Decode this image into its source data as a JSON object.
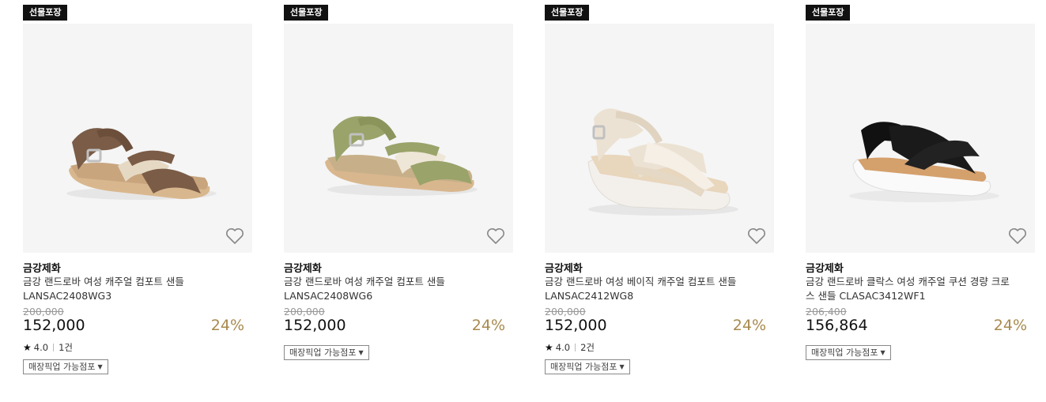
{
  "products": [
    {
      "badge": "선물포장",
      "brand": "금강제화",
      "name": "금강 랜드로바 여성 캐주얼 컴포트 샌들 LANSAC2408WG3",
      "original_price": "200,000",
      "price": "152,000",
      "discount": "24%",
      "rating": "4.0",
      "reviews": "1건",
      "pickup_label": "매장픽업 가능점포",
      "colors": {
        "strap": "#7a5c47",
        "accent": "#e6d9c4",
        "sole": "#d9b78e"
      }
    },
    {
      "badge": "선물포장",
      "brand": "금강제화",
      "name": "금강 랜드로바 여성 캐주얼 컴포트 샌들 LANSAC2408WG6",
      "original_price": "200,000",
      "price": "152,000",
      "discount": "24%",
      "rating": "",
      "reviews": "",
      "pickup_label": "매장픽업 가능점포",
      "colors": {
        "strap": "#9aa36a",
        "accent": "#eee6d6",
        "sole": "#d9b78e"
      }
    },
    {
      "badge": "선물포장",
      "brand": "금강제화",
      "name": "금강 랜드로바 여성 베이직 캐주얼 컴포트 샌들 LANSAC2412WG8",
      "original_price": "200,000",
      "price": "152,000",
      "discount": "24%",
      "rating": "4.0",
      "reviews": "2건",
      "pickup_label": "매장픽업 가능점포",
      "colors": {
        "strap": "#ece2d3",
        "accent": "#f5efe6",
        "sole": "#f3f0ec"
      }
    },
    {
      "badge": "선물포장",
      "brand": "금강제화",
      "name": "금강 랜드로바 클락스 여성 캐주얼 쿠션 경량 크로스 샌들 CLASAC3412WF1",
      "original_price": "206,400",
      "price": "156,864",
      "discount": "24%",
      "rating": "",
      "reviews": "",
      "pickup_label": "매장픽업 가능점포",
      "colors": {
        "strap": "#111111",
        "accent": "#222222",
        "sole": "#fafafa"
      }
    }
  ]
}
